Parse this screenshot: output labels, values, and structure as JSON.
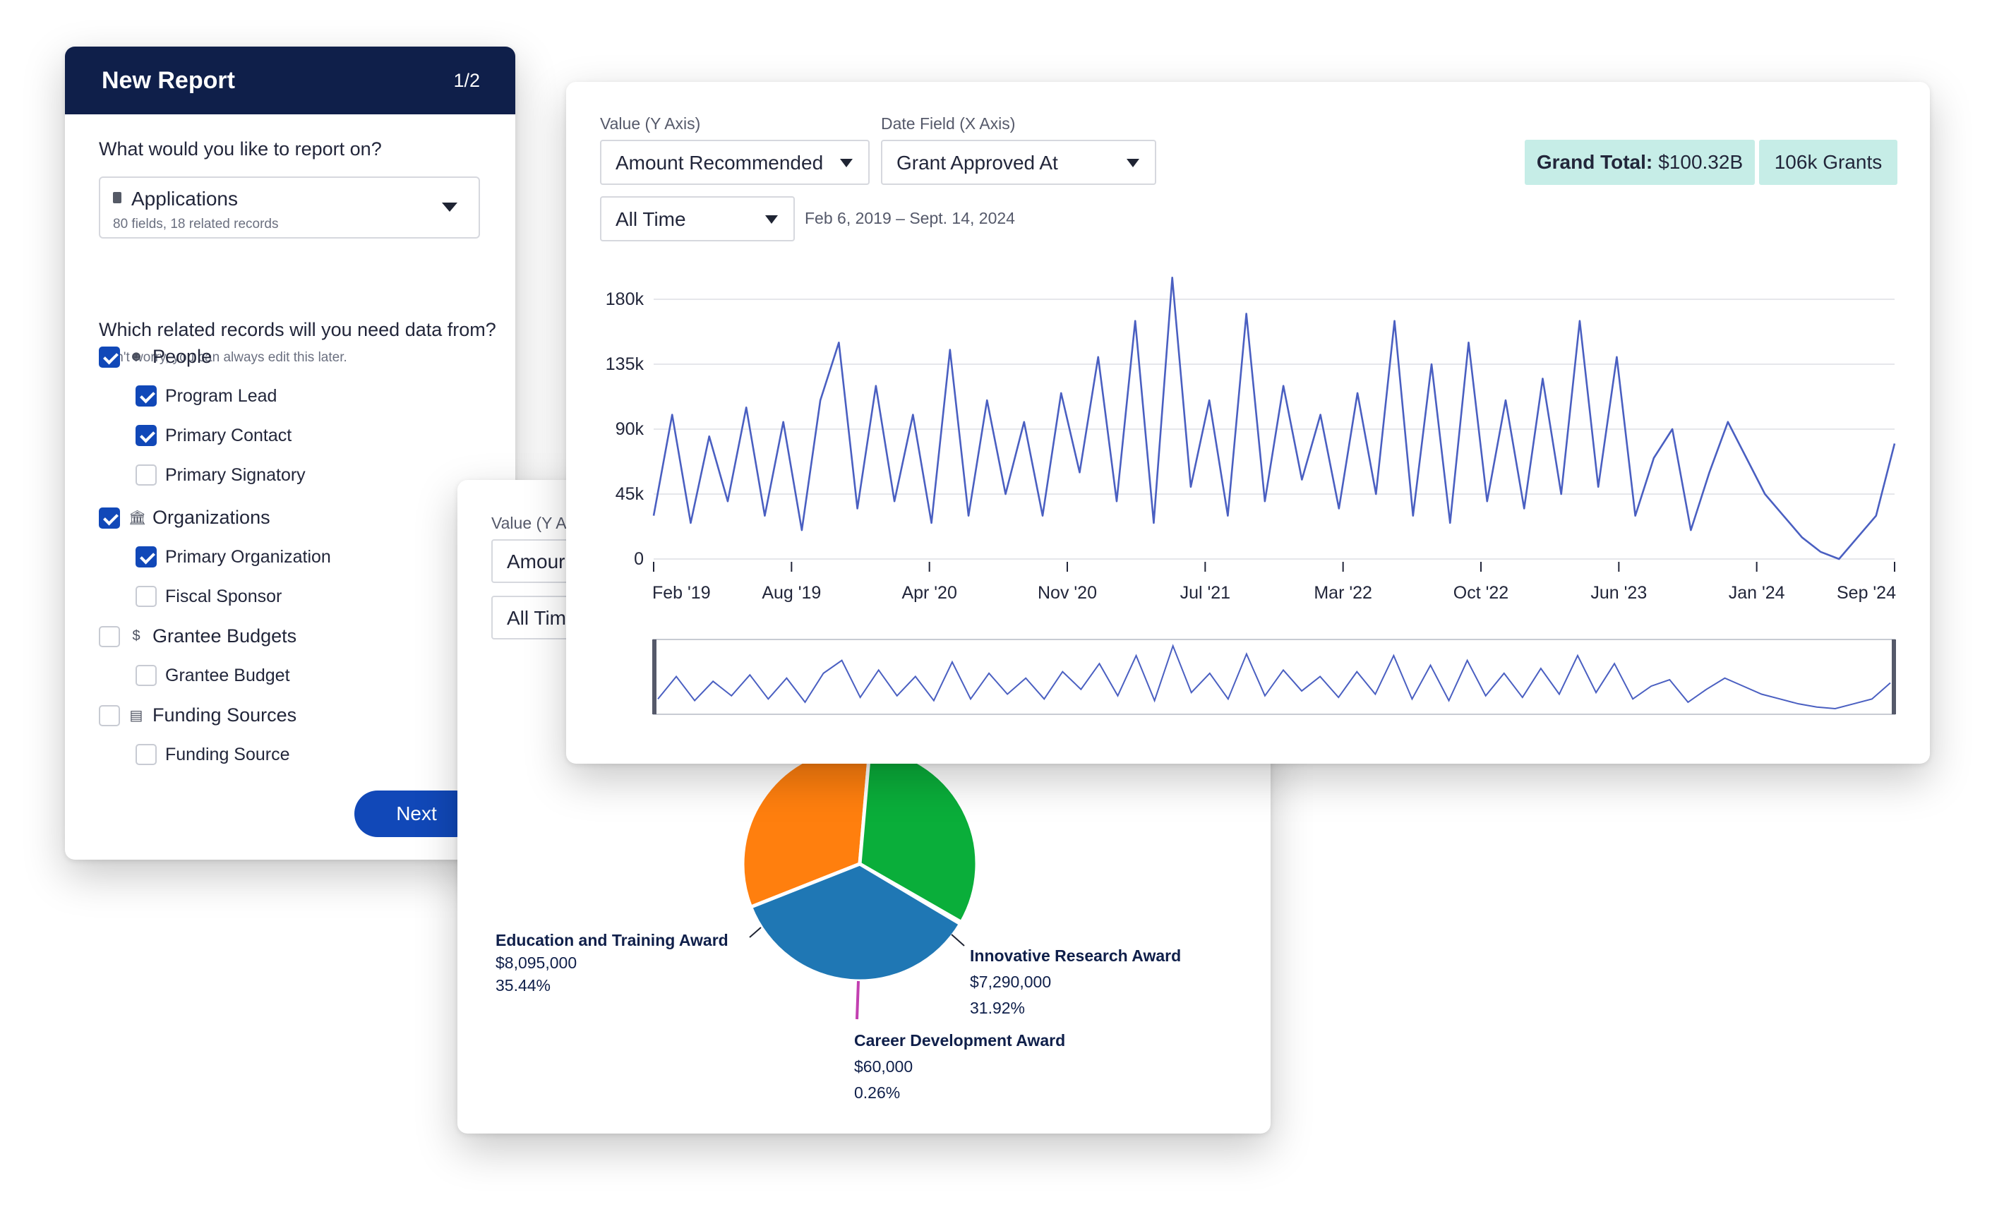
{
  "report": {
    "title": "New Report",
    "step": "1/2",
    "question": "What would you like to report on?",
    "select": {
      "title": "Applications",
      "subtitle": "80 fields, 18 related records",
      "icon": "document-icon"
    },
    "related_question": "Which related records will you need data from?",
    "related_hint": "Don't worry, you can always edit this later.",
    "groups": [
      {
        "label": "People",
        "icon": "person-icon",
        "checked": true,
        "items": [
          {
            "label": "Program Lead",
            "checked": true
          },
          {
            "label": "Primary Contact",
            "checked": true
          },
          {
            "label": "Primary Signatory",
            "checked": false
          }
        ]
      },
      {
        "label": "Organizations",
        "icon": "building-icon",
        "checked": true,
        "items": [
          {
            "label": "Primary Organization",
            "checked": true
          },
          {
            "label": "Fiscal Sponsor",
            "checked": false
          }
        ]
      },
      {
        "label": "Grantee Budgets",
        "icon": "budget-icon",
        "checked": false,
        "items": [
          {
            "label": "Grantee Budget",
            "checked": false
          }
        ]
      },
      {
        "label": "Funding Sources",
        "icon": "money-icon",
        "checked": false,
        "items": [
          {
            "label": "Funding Source",
            "checked": false
          }
        ]
      }
    ],
    "next_label": "Next"
  },
  "pie_card": {
    "value_label": "Value (Y A",
    "value_select": "Amour",
    "time_select": "All Tim"
  },
  "chart": {
    "value_label": "Value (Y Axis)",
    "value_select": "Amount Recommended",
    "date_label": "Date Field (X Axis)",
    "date_select": "Grant Approved At",
    "time_select": "All Time",
    "date_range": "Feb 6, 2019 – Sept. 14, 2024",
    "grand_total_label": "Grand Total:",
    "grand_total_value": "$100.32B",
    "grants_badge": "106k Grants"
  },
  "colors": {
    "navy": "#0f1f4a",
    "accent": "#1148b8",
    "line": "#4a5fc1",
    "badge": "#c6ede7"
  },
  "chart_data": [
    {
      "type": "line",
      "title": "",
      "xlabel": "",
      "ylabel": "",
      "ylim": [
        0,
        180000
      ],
      "y_ticks": [
        "0",
        "45k",
        "90k",
        "135k",
        "180k"
      ],
      "x_ticks": [
        "Feb '19",
        "Aug '19",
        "Apr '20",
        "Nov '20",
        "Jul '21",
        "Mar '22",
        "Oct '22",
        "Jun '23",
        "Jan '24",
        "Sep '24"
      ],
      "grid": true,
      "series": [
        {
          "x": [
            "2019-02",
            "2019-03",
            "2019-04",
            "2019-05",
            "2019-06",
            "2019-07",
            "2019-08",
            "2019-09",
            "2019-10",
            "2019-11",
            "2019-12",
            "2020-01",
            "2020-02",
            "2020-03",
            "2020-04",
            "2020-05",
            "2020-06",
            "2020-07",
            "2020-08",
            "2020-09",
            "2020-10",
            "2020-11",
            "2020-12",
            "2021-01",
            "2021-02",
            "2021-03",
            "2021-04",
            "2021-05",
            "2021-06",
            "2021-07",
            "2021-08",
            "2021-09",
            "2021-10",
            "2021-11",
            "2021-12",
            "2022-01",
            "2022-02",
            "2022-03",
            "2022-04",
            "2022-05",
            "2022-06",
            "2022-07",
            "2022-08",
            "2022-09",
            "2022-10",
            "2022-11",
            "2022-12",
            "2023-01",
            "2023-02",
            "2023-03",
            "2023-04",
            "2023-05",
            "2023-06",
            "2023-07",
            "2023-08",
            "2023-09",
            "2023-10",
            "2023-11",
            "2023-12",
            "2024-01",
            "2024-02",
            "2024-03",
            "2024-04",
            "2024-05",
            "2024-06",
            "2024-07",
            "2024-08",
            "2024-09"
          ],
          "values": [
            30000,
            100000,
            25000,
            85000,
            40000,
            105000,
            30000,
            95000,
            20000,
            110000,
            150000,
            35000,
            120000,
            40000,
            100000,
            25000,
            145000,
            30000,
            110000,
            45000,
            95000,
            30000,
            115000,
            60000,
            140000,
            40000,
            165000,
            25000,
            195000,
            50000,
            110000,
            30000,
            170000,
            40000,
            120000,
            55000,
            100000,
            35000,
            115000,
            45000,
            165000,
            30000,
            135000,
            25000,
            150000,
            40000,
            110000,
            35000,
            125000,
            45000,
            165000,
            50000,
            140000,
            30000,
            70000,
            90000,
            20000,
            60000,
            95000,
            70000,
            45000,
            30000,
            15000,
            5000,
            0,
            15000,
            30000,
            80000
          ]
        }
      ]
    },
    {
      "type": "pie",
      "title": "",
      "slices": [
        {
          "name": "Education and Training Award",
          "amount": "$8,095,000",
          "percent": "35.44%",
          "value": 35.44,
          "color": "#1f77b4"
        },
        {
          "name": "Innovative Research Award",
          "amount": "$7,290,000",
          "percent": "31.92%",
          "value": 31.92,
          "color": "#0aae3a"
        },
        {
          "name": "Career Development Award",
          "amount": "$60,000",
          "percent": "0.26%",
          "value": 0.26,
          "color": "#c23fb0"
        },
        {
          "name": "",
          "value": 32.38,
          "color": "#ff7f0e"
        }
      ]
    }
  ]
}
